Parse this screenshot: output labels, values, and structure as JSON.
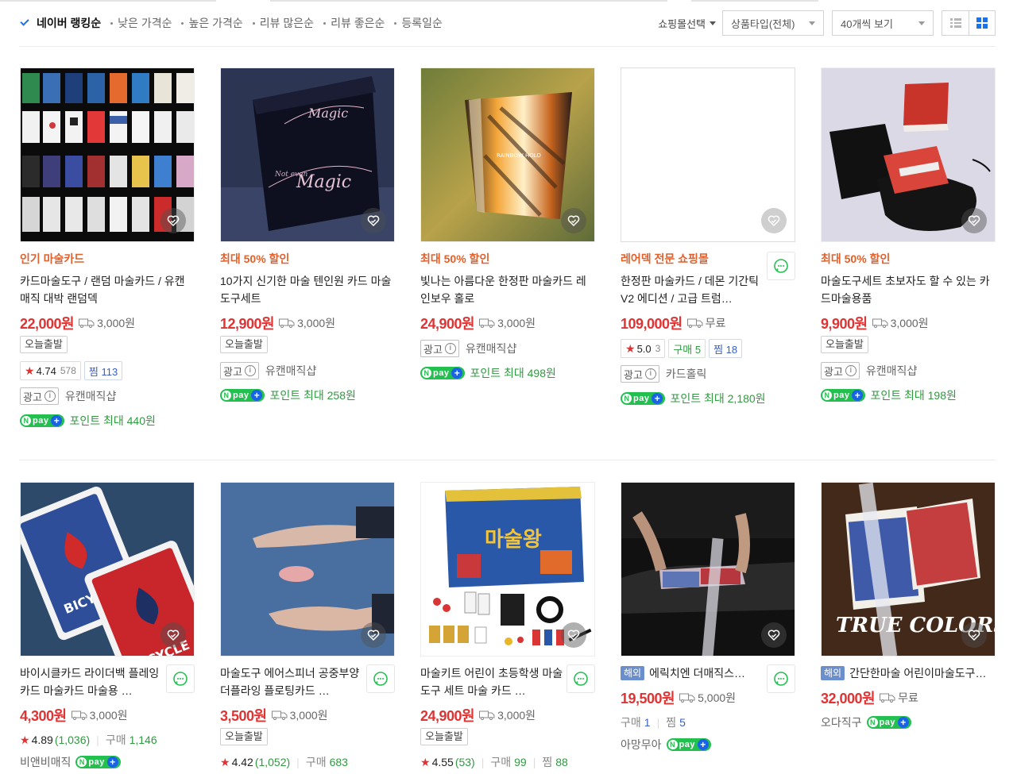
{
  "sort": {
    "active_label": "네이버 랭킹순",
    "items": [
      "낮은 가격순",
      "높은 가격순",
      "리뷰 많은순",
      "리뷰 좋은순",
      "등록일순"
    ]
  },
  "filters": {
    "mall_select": "쇼핑몰선택",
    "product_type": "상품타입(전체)",
    "page_size": "40개씩 보기"
  },
  "products": [
    {
      "promo": "인기 마술카드",
      "title": "카드마술도구 / 랜덤 마술카드 / 유캔매직 대박 랜덤덱",
      "price": "22,000원",
      "shipping": "3,000원",
      "badge": "오늘출발",
      "rating": "4.74",
      "review_count": "578",
      "zzim": "찜 113",
      "ad_label": "광고",
      "mall": "유캔매직샵",
      "point": "포인트 최대 440원"
    },
    {
      "promo": "최대 50% 할인",
      "title": "10가지 신기한 마술 텐인원 카드 마술도구세트",
      "price": "12,900원",
      "shipping": "3,000원",
      "badge": "오늘출발",
      "ad_label": "광고",
      "mall": "유캔매직샵",
      "point": "포인트 최대 258원"
    },
    {
      "promo": "최대 50% 할인",
      "title": "빛나는 아름다운 한정판 마술카드 레인보우 홀로",
      "price": "24,900원",
      "shipping": "3,000원",
      "ad_label": "광고",
      "mall": "유캔매직샵",
      "point": "포인트 최대 498원"
    },
    {
      "promo": "레어덱 전문 쇼핑몰",
      "title": "한정판 마술카드 / 데몬 기간틱 V2 에디션 / 고급 트럼…",
      "price": "109,000원",
      "shipping": "무료",
      "rating": "5.0",
      "review_count": "3",
      "buy": "구매 5",
      "zzim": "찜 18",
      "ad_label": "광고",
      "mall": "카드홀릭",
      "point": "포인트 최대 2,180원"
    },
    {
      "promo": "최대 50% 할인",
      "title": "마술도구세트 초보자도 할 수 있는 카드마술용품",
      "price": "9,900원",
      "shipping": "3,000원",
      "badge": "오늘출발",
      "ad_label": "광고",
      "mall": "유캔매직샵",
      "point": "포인트 최대 198원"
    },
    {
      "title": "바이시클카드 라이더백 플레잉카드 마술카드 마술용 …",
      "price": "4,300원",
      "shipping": "3,000원",
      "rating": "4.89",
      "review_count": "(1,036)",
      "buy_label": "구매",
      "buy_count": "1,146",
      "mall": "비앤비매직"
    },
    {
      "title": "마술도구 에어스피너 공중부양 더플라잉 플로팅카드 …",
      "price": "3,500원",
      "shipping": "3,000원",
      "badge": "오늘출발",
      "rating": "4.42",
      "review_count": "(1,052)",
      "buy_label": "구매",
      "buy_count": "683"
    },
    {
      "title": "마술키트 어린이 초등학생 마술도구 세트 마술 카드 …",
      "price": "24,900원",
      "shipping": "3,000원",
      "badge": "오늘출발",
      "rating": "4.55",
      "review_count": "(53)",
      "buy_label": "구매",
      "buy_count": "99",
      "zzim_label": "찜",
      "zzim_count": "88"
    },
    {
      "overseas": "해외",
      "title": "에릭치엔 더매직스…",
      "price": "19,500원",
      "shipping": "5,000원",
      "buy_label": "구매",
      "buy_count": "1",
      "zzim_label": "찜",
      "zzim_count": "5",
      "mall": "아망무아"
    },
    {
      "overseas": "해외",
      "title": "간단한마술 어린이마술도구…",
      "price": "32,000원",
      "shipping": "무료",
      "mall": "오다직구"
    }
  ],
  "images": {
    "p2_text": "Magic",
    "p2_text_small": "Not even",
    "p3_text": "RAINBOW HOLO",
    "p6_text": "BICYCLE",
    "p8_text": "마술왕",
    "p10_text": "TRUE COLORS"
  },
  "colors": {
    "price": "#e03333",
    "promo": "#e2602b",
    "accent": "#1a73e8",
    "npay": "#23c050"
  }
}
